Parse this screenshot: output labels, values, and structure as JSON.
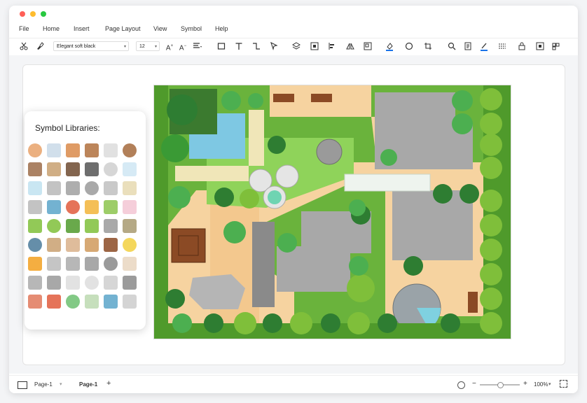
{
  "window": {
    "traffic_lights": [
      "#ff5f57",
      "#febc2e",
      "#28c840"
    ]
  },
  "menu": {
    "items": [
      "File",
      "Home",
      "Insert",
      "Page Layout",
      "View",
      "Symbol",
      "Help"
    ]
  },
  "toolbar": {
    "font_name": "Elegant soft black",
    "font_size": "12",
    "icons": [
      "scissors-icon",
      "format-painter-icon",
      "font-grow-icon",
      "font-shrink-icon",
      "align-icon",
      "rectangle-icon",
      "text-icon",
      "connector-icon",
      "pointer-icon",
      "layers-icon",
      "group-icon",
      "align-left-icon",
      "flip-icon",
      "frame-icon",
      "fill-color-icon",
      "shape-style-icon",
      "crop-icon",
      "search-icon",
      "document-icon",
      "line-color-icon",
      "line-style-icon",
      "lock-icon",
      "fit-icon",
      "more-icon"
    ]
  },
  "symbol_panel": {
    "title": "Symbol Libraries:"
  },
  "statusbar": {
    "page_selector": "Page-1",
    "active_page_tab": "Page-1",
    "add_page": "+",
    "zoom_out": "−",
    "zoom_in": "+",
    "zoom_level": "100%",
    "zoom_fraction": 0.5
  }
}
